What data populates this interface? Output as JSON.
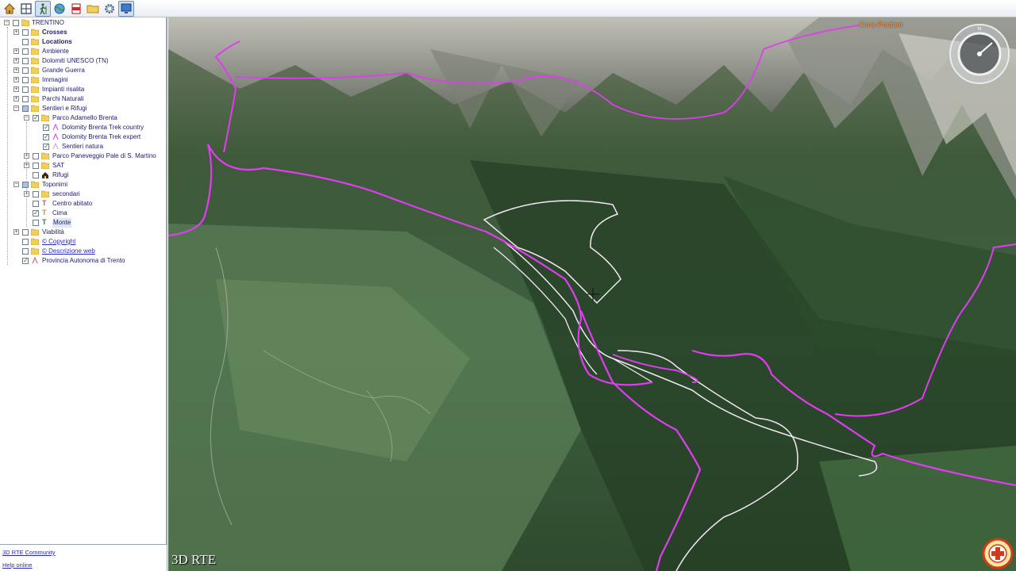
{
  "tree": {
    "root": "TRENTINO",
    "items": [
      {
        "label": "Crosses",
        "bold": true
      },
      {
        "label": "Locations",
        "bold": true
      },
      {
        "label": "Ambiente"
      },
      {
        "label": "Dolomiti UNESCO (TN)"
      },
      {
        "label": "Grande Guerra"
      },
      {
        "label": "Immagini"
      },
      {
        "label": "Impianti risalita"
      },
      {
        "label": "Parchi Naturali"
      },
      {
        "label": "Sentieri e Rifugi"
      },
      {
        "label": "Parco Adamello Brenta"
      },
      {
        "label": "Dolomity Brenta Trek country"
      },
      {
        "label": "Dolomity Brenta Trek expert"
      },
      {
        "label": "Sentieri natura"
      },
      {
        "label": "Parco Paneveggio Pale di S. Martino"
      },
      {
        "label": "SAT"
      },
      {
        "label": "Rifugi"
      },
      {
        "label": "Toponimi"
      },
      {
        "label": "secondari"
      },
      {
        "label": "Centro abitato"
      },
      {
        "label": "Cima"
      },
      {
        "label": "Monte"
      },
      {
        "label": "Viabilità"
      },
      {
        "label": "© Copyright"
      },
      {
        "label": "© Descrizione web"
      },
      {
        "label": "Provincia Autonoma di Trento"
      }
    ]
  },
  "footer": {
    "community": "3D RTE Community",
    "help": "Help online"
  },
  "map": {
    "watermark": "3D RTE",
    "peak_label": "Cima Pradont"
  },
  "colors": {
    "trail_magenta": "#e03cf0",
    "trail_white": "#f2e8f2",
    "accent": "#2a2ac0"
  }
}
